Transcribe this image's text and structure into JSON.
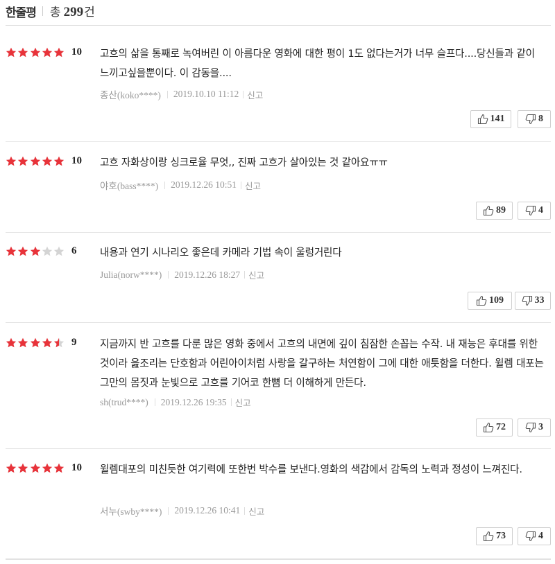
{
  "header": {
    "title": "한줄평",
    "total_prefix": "총",
    "total_count": "299",
    "total_unit": "건"
  },
  "colors": {
    "star_on": "#e8333a",
    "star_off": "#d4d4d4"
  },
  "reviews": [
    {
      "rating_stars": 5,
      "score": "10",
      "text": "고흐의 삶을 통째로 녹여버린 이 아름다운 영화에 대한 평이 1도 없다는거가 너무 슬프다....당신들과 같이 느끼고싶을뿐이다. 이 감동을....",
      "author": "종산(koko****)",
      "date": "2019.10.10 11:12",
      "report": "신고",
      "likes": "141",
      "dislikes": "8"
    },
    {
      "rating_stars": 5,
      "score": "10",
      "text": "고흐 자화상이랑 싱크로율 무엇,, 진짜 고흐가 살아있는 것 같아요ㅠㅠ",
      "author": "야호(bass****)",
      "date": "2019.12.26 10:51",
      "report": "신고",
      "likes": "89",
      "dislikes": "4"
    },
    {
      "rating_stars": 3,
      "score": "6",
      "text": "내용과 연기 시나리오 좋은데 카메라 기법 속이 울렁거린다",
      "author": "Julia(norw****)",
      "date": "2019.12.26 18:27",
      "report": "신고",
      "likes": "109",
      "dislikes": "33"
    },
    {
      "rating_stars": 4.5,
      "score": "9",
      "text": "지금까지 반 고흐를 다룬 많은 영화 중에서 고흐의 내면에 깊이 침잠한 손꼽는 수작. 내 재능은 후대를 위한 것이라 읊조리는 단호함과 어린아이처럼 사랑을 갈구하는 처연함이 그에 대한 애틋함을 더한다. 윌렘 대포는 그만의 몸짓과 눈빛으로 고흐를 기어코 한뼘 더 이해하게 만든다.",
      "author": "sh(trud****)",
      "date": "2019.12.26 19:35",
      "report": "신고",
      "likes": "72",
      "dislikes": "3"
    },
    {
      "rating_stars": 5,
      "score": "10",
      "text": "윌렘대포의 미친듯한 여기력에 또한번 박수를 보낸다.영화의 색감에서 감독의 노력과 정성이 느껴진다.",
      "author": "서누(swby****)",
      "date": "2019.12.26 10:41",
      "report": "신고",
      "likes": "73",
      "dislikes": "4"
    }
  ]
}
